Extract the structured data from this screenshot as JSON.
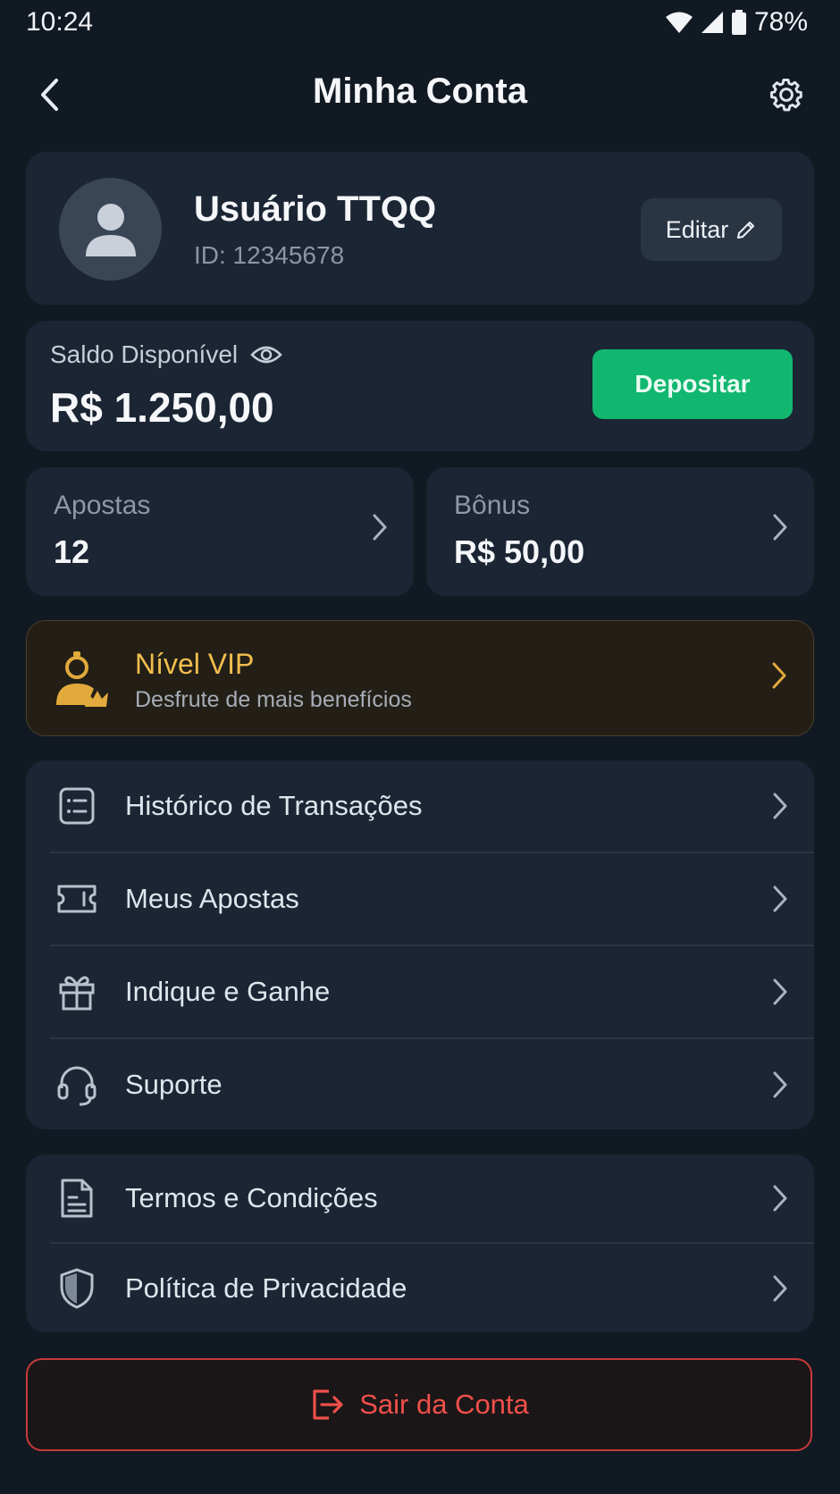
{
  "status_bar": {
    "time": "10:24",
    "battery": "78%"
  },
  "header": {
    "title": "Minha Conta"
  },
  "profile": {
    "name": "Usuário TTQQ",
    "id": "ID: 12345678",
    "edit_label": "Editar"
  },
  "balance": {
    "label": "Saldo Disponível",
    "value": "R$ 1.250,00",
    "deposit_label": "Depositar"
  },
  "stats": [
    {
      "label": "Apostas",
      "value": "12"
    },
    {
      "label": "Bônus",
      "value": "R$ 50,00"
    }
  ],
  "vip": {
    "title": "Nível VIP",
    "subtitle": "Desfrute de mais benefícios"
  },
  "menu_main": [
    {
      "label": "Histórico de Transações",
      "icon": "list-icon"
    },
    {
      "label": "Meus Apostas",
      "icon": "ticket-icon"
    },
    {
      "label": "Indique e Ganhe",
      "icon": "gift-icon"
    },
    {
      "label": "Suporte",
      "icon": "headset-icon"
    }
  ],
  "menu_legal": [
    {
      "label": "Termos e Condições",
      "icon": "document-icon"
    },
    {
      "label": "Política de Privacidade",
      "icon": "shield-icon"
    }
  ],
  "logout": {
    "label": "Sair da Conta"
  },
  "colors": {
    "background": "#111923",
    "card": "#1b2533",
    "accent_green": "#11b76f",
    "vip_gold": "#f1be4f",
    "danger": "#f0504a"
  }
}
